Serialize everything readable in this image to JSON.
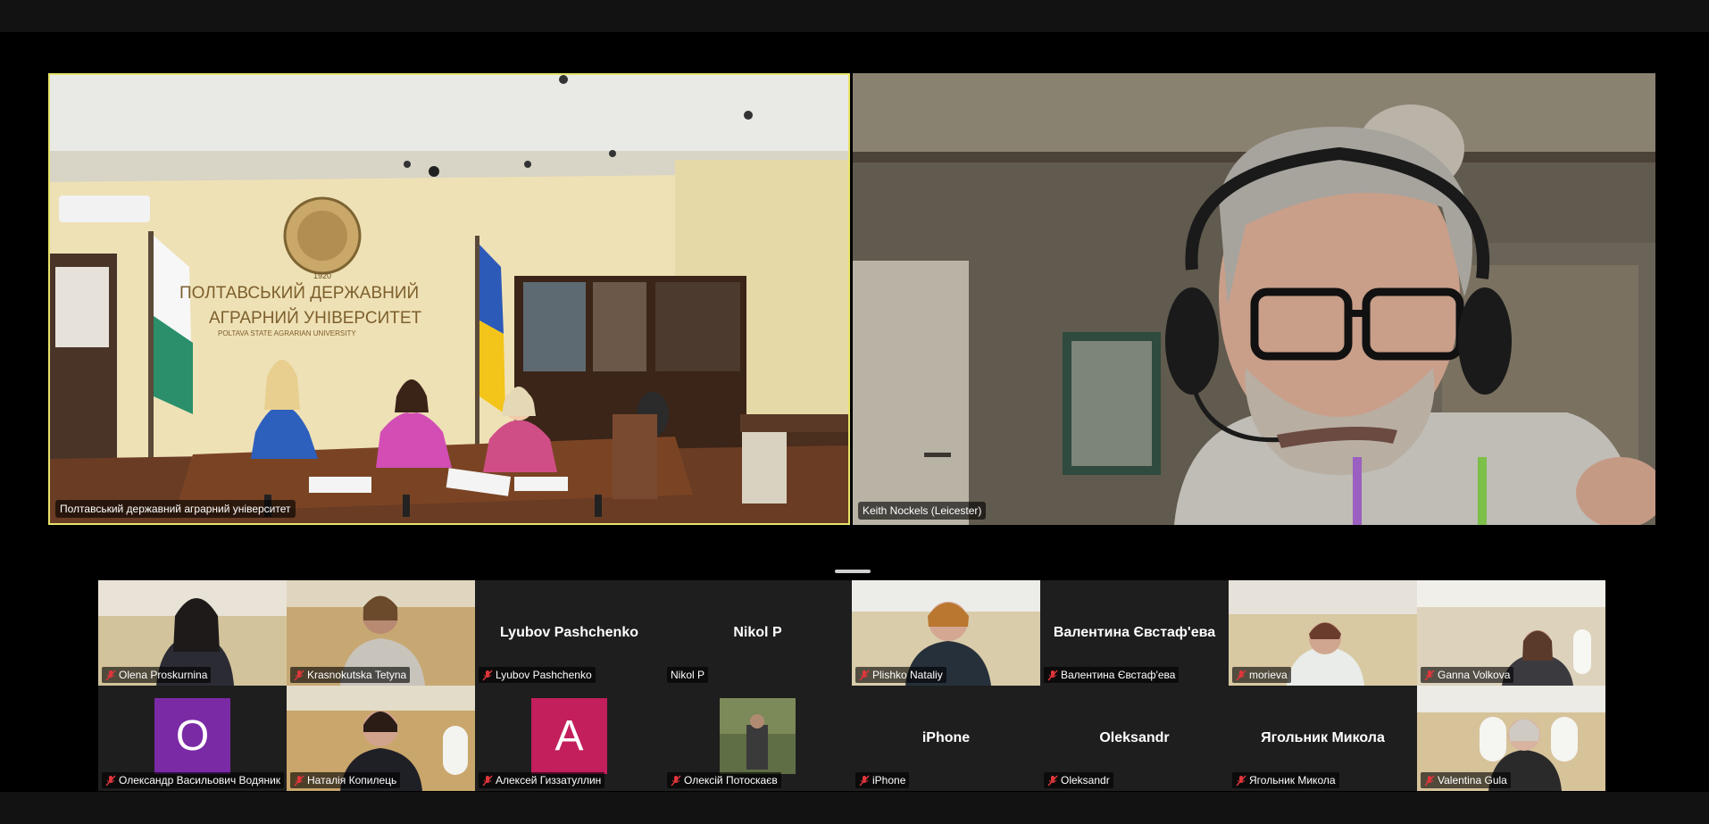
{
  "main_tiles": [
    {
      "name": "Полтавський державний аграрний університет"
    },
    {
      "name": "Keith Nockels (Leicester)"
    }
  ],
  "room_sign": {
    "line1": "ПОЛТАВСЬКИЙ ДЕРЖАВНИЙ",
    "line2": "АГРАРНИЙ УНІВЕРСИТЕТ",
    "line3": "POLTAVA STATE AGRARIAN UNIVERSITY",
    "seal_year": "1920"
  },
  "gallery": [
    {
      "name": "Olena Proskurnina",
      "muted": true
    },
    {
      "name": "Krasnokutska Tetyna",
      "muted": true
    },
    {
      "name": "Lyubov Pashchenko",
      "display": "Lyubov Pashchenko",
      "muted": true
    },
    {
      "name": "Nikol P",
      "display": "Nikol P",
      "muted": false
    },
    {
      "name": "Plishko Nataliy",
      "muted": true
    },
    {
      "name": "Валентина Євстаф'ева",
      "display": "Валентина Євстаф'ева",
      "muted": true
    },
    {
      "name": "morieva",
      "muted": true
    },
    {
      "name": "Ganna Volkova",
      "muted": true
    },
    {
      "name": "Олександр Васильович Водяник",
      "avatar_letter": "O",
      "avatar_color": "#7b2aa6",
      "muted": true
    },
    {
      "name": "Наталія Копилець",
      "muted": true
    },
    {
      "name": "Алексей Гиззатуллин",
      "avatar_letter": "A",
      "avatar_color": "#c21f5c",
      "muted": true
    },
    {
      "name": "Олексій Потоскаєв",
      "muted": true
    },
    {
      "name": "iPhone",
      "display": "iPhone",
      "muted": true
    },
    {
      "name": "Oleksandr",
      "display": "Oleksandr",
      "muted": true
    },
    {
      "name": "Ягольник Микола",
      "display": "Ягольник Микола",
      "muted": true
    },
    {
      "name": "Valentina Gula",
      "muted": true
    }
  ],
  "colors": {
    "active_speaker_border": "#e8e46a",
    "muted_icon": "#e0363b",
    "tile_bg": "#1e1e1e"
  },
  "icons": {
    "muted": "mic-off-icon"
  }
}
